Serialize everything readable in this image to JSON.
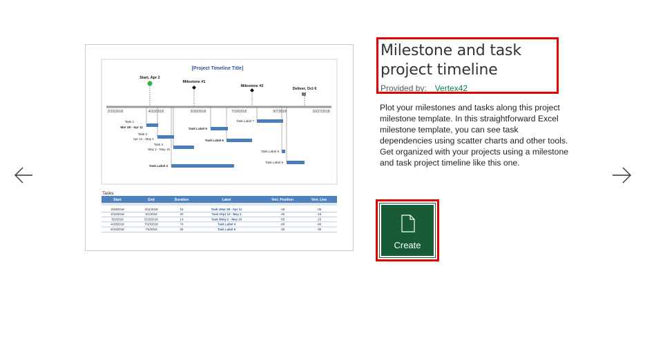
{
  "navigation": {
    "prev_icon": "arrow-left-icon",
    "next_icon": "arrow-right-icon"
  },
  "template": {
    "title": "Milestone and task project timeline",
    "provided_by_label": "Provided by:",
    "provider": "Vertex42",
    "description": "Plot your milestones and tasks along this project milestone template. In this straightforward Excel milestone template, you can see task dependencies using scatter charts and other tools. Get organized with your projects using a milestone and task project timeline like this one.",
    "create_label": "Create",
    "create_icon": "document-icon"
  },
  "preview": {
    "chart_title": "[Project Timeline Title]",
    "milestones": [
      "Start, Apr 2",
      "Milestone #1",
      "Milestone #2",
      "Deliver, Oct 6"
    ],
    "axis_dates": [
      "2/15/2018",
      "4/10/2018",
      "5/30/2018",
      "7/19/2018",
      "9/7/2018",
      "10/27/2018"
    ],
    "task_labels": [
      "Task 1",
      "Mar 28 - Apr 11",
      "Task 2",
      "Apr 12 - May 1",
      "Task 3",
      "May 2 - May 15",
      "Task Label 4",
      "Task Label 5",
      "Task Label 6",
      "Task Label 7",
      "Task Label 8",
      "Task Label 9"
    ],
    "tasks_heading": "Tasks",
    "table_headers": [
      "Start",
      "End",
      "Duration",
      "Label",
      "Vert. Position",
      "Vert. Line"
    ],
    "table_rows": [
      [
        "3/28/2018",
        "4/11/2018",
        "15",
        "Task 1Mar 28 - Apr 11",
        "-25",
        "-25"
      ],
      [
        "4/12/2018",
        "5/1/2018",
        "20",
        "Task 2Apr 12 - May 1",
        "-40",
        "-15"
      ],
      [
        "5/2/2018",
        "5/15/2018",
        "14",
        "Task 3May 2 - May 15",
        "-55",
        "-15"
      ],
      [
        "4/28/2018",
        "7/10/2018",
        "74",
        "Task Label 4",
        "-80",
        "-80"
      ],
      [
        "6/15/2018",
        "7/4/2018",
        "20",
        "Task Label 5",
        "-30",
        "-30"
      ]
    ]
  },
  "colors": {
    "highlight": "#e00000",
    "create_bg": "#185c37",
    "provider": "#107c41",
    "bar": "#4a7ebb",
    "table_header": "#4f81bd"
  }
}
